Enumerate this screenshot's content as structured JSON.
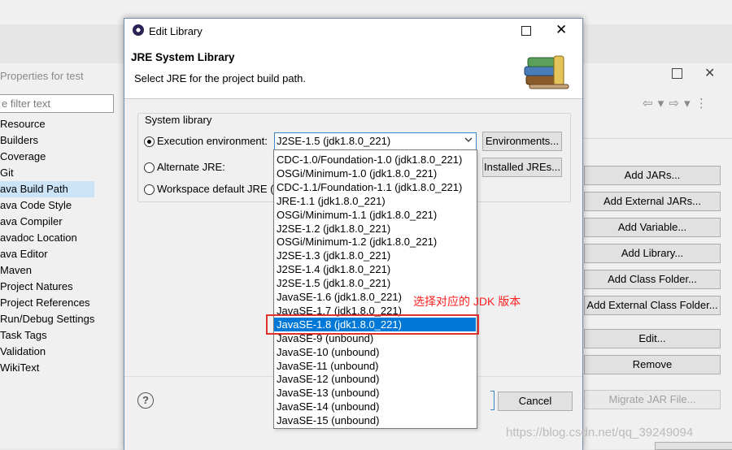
{
  "background": {
    "title": "Properties for test",
    "filter_placeholder": "e filter text",
    "nav_items": [
      "Resource",
      "Builders",
      "Coverage",
      "Git",
      "ava Build Path",
      "ava Code Style",
      "ava Compiler",
      "avadoc Location",
      "ava Editor",
      "Maven",
      "Project Natures",
      "Project References",
      "Run/Debug Settings",
      "Task Tags",
      "Validation",
      "WikiText"
    ],
    "selected_nav": "ava Build Path",
    "toolbar_icons": "⇦ ▾ ⇨ ▾ ⋮",
    "buttons": [
      "Add JARs...",
      "Add External JARs...",
      "Add Variable...",
      "Add Library...",
      "Add Class Folder...",
      "Add External Class Folder...",
      "Edit...",
      "Remove",
      "Migrate JAR File..."
    ]
  },
  "dialog": {
    "title": "Edit Library",
    "heading": "JRE System Library",
    "subheading": "Select JRE for the project build path.",
    "group_label": "System library",
    "exec_env_label": "Execution environment:",
    "alt_jre_label": "Alternate JRE:",
    "workspace_label": "Workspace default JRE (",
    "combo_value": "J2SE-1.5 (jdk1.8.0_221)",
    "environments_button": "Environments...",
    "installed_jres_button": "Installed JREs...",
    "cancel_button": "Cancel",
    "help_symbol": "?"
  },
  "dropdown": {
    "options": [
      "CDC-1.0/Foundation-1.0 (jdk1.8.0_221)",
      "OSGi/Minimum-1.0 (jdk1.8.0_221)",
      "CDC-1.1/Foundation-1.1 (jdk1.8.0_221)",
      "JRE-1.1 (jdk1.8.0_221)",
      "OSGi/Minimum-1.1 (jdk1.8.0_221)",
      "J2SE-1.2 (jdk1.8.0_221)",
      "OSGi/Minimum-1.2 (jdk1.8.0_221)",
      "J2SE-1.3 (jdk1.8.0_221)",
      "J2SE-1.4 (jdk1.8.0_221)",
      "J2SE-1.5 (jdk1.8.0_221)",
      "JavaSE-1.6 (jdk1.8.0_221)",
      "JavaSE-1.7 (jdk1.8.0_221)",
      "JavaSE-1.8 (jdk1.8.0_221)",
      "JavaSE-9 (unbound)",
      "JavaSE-10 (unbound)",
      "JavaSE-11 (unbound)",
      "JavaSE-12 (unbound)",
      "JavaSE-13 (unbound)",
      "JavaSE-14 (unbound)",
      "JavaSE-15 (unbound)"
    ],
    "selected": "JavaSE-1.8 (jdk1.8.0_221)"
  },
  "annotation": "选择对应的 JDK 版本",
  "watermark": "https://blog.csdn.net/qq_39249094",
  "colors": {
    "selection": "#0078d7",
    "annotation": "#ff2020",
    "nav_selection": "#cce4f7"
  }
}
